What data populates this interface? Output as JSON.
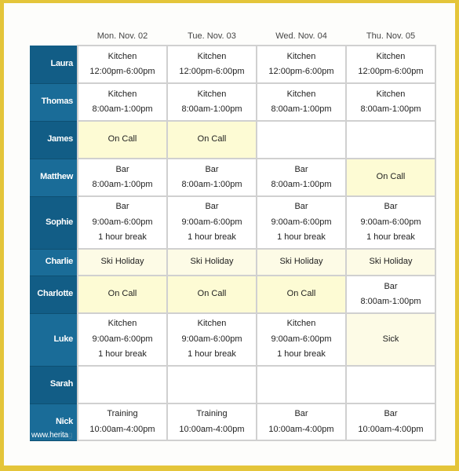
{
  "days": [
    "Mon. Nov. 02",
    "Tue. Nov. 03",
    "Wed. Nov. 04",
    "Thu. Nov. 05"
  ],
  "colors": {
    "frame": "#e4c53a",
    "name_dark": "#125d86",
    "name_light": "#1a6c98",
    "on_call": "#fdfbd4",
    "leave": "#fdfbe6",
    "grid_line": "#d0d0d0"
  },
  "rows": [
    {
      "name": "Laura",
      "cells": [
        {
          "type": "shift",
          "lines": [
            "Kitchen",
            "12:00pm-6:00pm"
          ]
        },
        {
          "type": "shift",
          "lines": [
            "Kitchen",
            "12:00pm-6:00pm"
          ]
        },
        {
          "type": "shift",
          "lines": [
            "Kitchen",
            "12:00pm-6:00pm"
          ]
        },
        {
          "type": "shift",
          "lines": [
            "Kitchen",
            "12:00pm-6:00pm"
          ]
        }
      ]
    },
    {
      "name": "Thomas",
      "cells": [
        {
          "type": "shift",
          "lines": [
            "Kitchen",
            "8:00am-1:00pm"
          ]
        },
        {
          "type": "shift",
          "lines": [
            "Kitchen",
            "8:00am-1:00pm"
          ]
        },
        {
          "type": "shift",
          "lines": [
            "Kitchen",
            "8:00am-1:00pm"
          ]
        },
        {
          "type": "shift",
          "lines": [
            "Kitchen",
            "8:00am-1:00pm"
          ]
        }
      ]
    },
    {
      "name": "James",
      "cells": [
        {
          "type": "oncall",
          "lines": [
            "On Call"
          ]
        },
        {
          "type": "oncall",
          "lines": [
            "On Call"
          ]
        },
        {
          "type": "empty",
          "lines": []
        },
        {
          "type": "empty",
          "lines": []
        }
      ]
    },
    {
      "name": "Matthew",
      "cells": [
        {
          "type": "shift",
          "lines": [
            "Bar",
            "8:00am-1:00pm"
          ]
        },
        {
          "type": "shift",
          "lines": [
            "Bar",
            "8:00am-1:00pm"
          ]
        },
        {
          "type": "shift",
          "lines": [
            "Bar",
            "8:00am-1:00pm"
          ]
        },
        {
          "type": "oncall",
          "lines": [
            "On Call"
          ]
        }
      ]
    },
    {
      "name": "Sophie",
      "cells": [
        {
          "type": "shift",
          "lines": [
            "Bar",
            "9:00am-6:00pm",
            "1 hour break"
          ]
        },
        {
          "type": "shift",
          "lines": [
            "Bar",
            "9:00am-6:00pm",
            "1 hour break"
          ]
        },
        {
          "type": "shift",
          "lines": [
            "Bar",
            "9:00am-6:00pm",
            "1 hour break"
          ]
        },
        {
          "type": "shift",
          "lines": [
            "Bar",
            "9:00am-6:00pm",
            "1 hour break"
          ]
        }
      ]
    },
    {
      "name": "Charlie",
      "cells": [
        {
          "type": "leave",
          "lines": [
            "Ski Holiday"
          ]
        },
        {
          "type": "leave",
          "lines": [
            "Ski Holiday"
          ]
        },
        {
          "type": "leave",
          "lines": [
            "Ski Holiday"
          ]
        },
        {
          "type": "leave",
          "lines": [
            "Ski Holiday"
          ]
        }
      ]
    },
    {
      "name": "Charlotte",
      "cells": [
        {
          "type": "oncall",
          "lines": [
            "On Call"
          ]
        },
        {
          "type": "oncall",
          "lines": [
            "On Call"
          ]
        },
        {
          "type": "oncall",
          "lines": [
            "On Call"
          ]
        },
        {
          "type": "shift",
          "lines": [
            "Bar",
            "8:00am-1:00pm"
          ]
        }
      ]
    },
    {
      "name": "Luke",
      "cells": [
        {
          "type": "shift",
          "lines": [
            "Kitchen",
            "9:00am-6:00pm",
            "1 hour break"
          ]
        },
        {
          "type": "shift",
          "lines": [
            "Kitchen",
            "9:00am-6:00pm",
            "1 hour break"
          ]
        },
        {
          "type": "shift",
          "lines": [
            "Kitchen",
            "9:00am-6:00pm",
            "1 hour break"
          ]
        },
        {
          "type": "leave",
          "lines": [
            "Sick"
          ]
        }
      ]
    },
    {
      "name": "Sarah",
      "cells": [
        {
          "type": "empty",
          "lines": []
        },
        {
          "type": "empty",
          "lines": []
        },
        {
          "type": "empty",
          "lines": []
        },
        {
          "type": "empty",
          "lines": []
        }
      ]
    },
    {
      "name": "Nick",
      "cells": [
        {
          "type": "shift",
          "lines": [
            "Training",
            "10:00am-4:00pm"
          ]
        },
        {
          "type": "shift",
          "lines": [
            "Training",
            "10:00am-4:00pm"
          ]
        },
        {
          "type": "shift",
          "lines": [
            "Bar",
            "10:00am-4:00pm"
          ]
        },
        {
          "type": "shift",
          "lines": [
            "Bar",
            "10:00am-4:00pm"
          ]
        }
      ]
    }
  ],
  "watermark": {
    "visible": "www.herita",
    "faded": "g"
  }
}
